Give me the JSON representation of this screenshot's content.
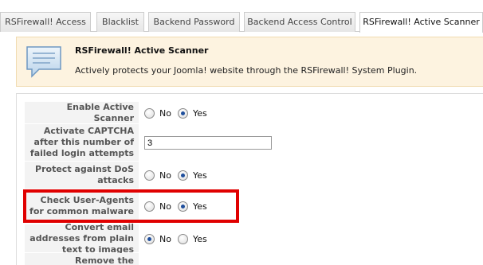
{
  "tabs": [
    {
      "label": "RSFirewall! Access"
    },
    {
      "label": "Blacklist"
    },
    {
      "label": "Backend Password"
    },
    {
      "label": "Backend Access Control"
    },
    {
      "label": "RSFirewall! Active Scanner",
      "active": true
    }
  ],
  "info": {
    "title": "RSFirewall! Active Scanner",
    "description": "Actively protects your Joomla! website through the RSFirewall! System Plugin.",
    "icon": "message-box-icon"
  },
  "rows": {
    "enable_active_scanner": {
      "label": "Enable Active Scanner",
      "no": "No",
      "yes": "Yes",
      "selected": "yes"
    },
    "captcha_attempts": {
      "label": "Activate CAPTCHA after this number of failed login attempts",
      "value": "3"
    },
    "protect_dos": {
      "label": "Protect against DoS attacks",
      "no": "No",
      "yes": "Yes",
      "selected": "yes"
    },
    "check_user_agents": {
      "label": "Check User-Agents for common malware",
      "no": "No",
      "yes": "Yes",
      "selected": "yes"
    },
    "convert_emails": {
      "label": "Convert email addresses from plain text to images",
      "no": "No",
      "yes": "Yes",
      "selected": "no"
    },
    "remove_generator": {
      "label": "Remove the generator"
    }
  },
  "colors": {
    "highlight": "#e00000",
    "info_bg": "#fdf3e0",
    "radio_dot": "#1f4f9c"
  }
}
